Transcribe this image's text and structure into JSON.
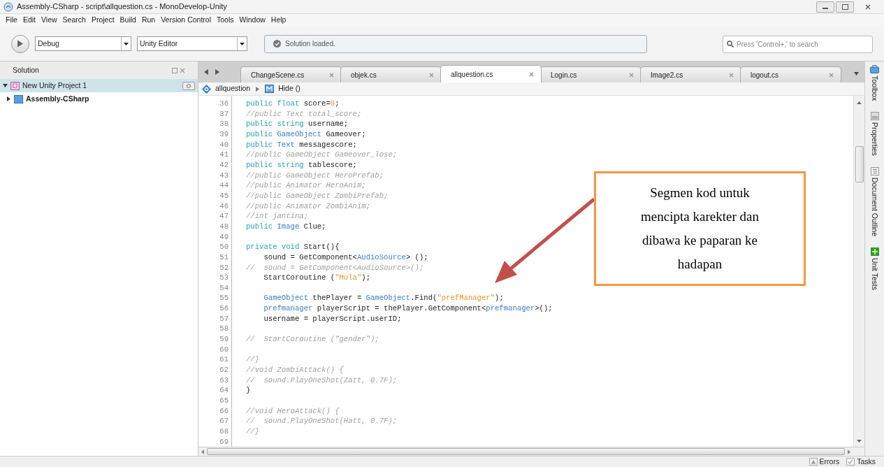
{
  "window": {
    "title": "Assembly-CSharp - script\\allquestion.cs - MonoDevelop-Unity"
  },
  "menu": [
    "File",
    "Edit",
    "View",
    "Search",
    "Project",
    "Build",
    "Run",
    "Version Control",
    "Tools",
    "Window",
    "Help"
  ],
  "toolbar": {
    "configuration": "Debug",
    "target": "Unity Editor",
    "status": "Solution loaded.",
    "search": {
      "placeholder": "Press 'Control+,' to search"
    }
  },
  "solution_pad": {
    "title": "Solution",
    "tree": [
      {
        "label": "New Unity Project 1",
        "expanded": true,
        "selected": true,
        "children": [
          {
            "label": "Assembly-CSharp",
            "expanded": false,
            "selected": false
          }
        ]
      }
    ]
  },
  "tabs": [
    {
      "label": "ChangeScene.cs",
      "selected": false
    },
    {
      "label": "objek.cs",
      "selected": false
    },
    {
      "label": "allquestion.cs",
      "selected": true
    },
    {
      "label": "Login.cs",
      "selected": false
    },
    {
      "label": "Image2.cs",
      "selected": false
    },
    {
      "label": "logout.cs",
      "selected": false
    }
  ],
  "breadcrumb": [
    {
      "label": "allquestion",
      "kind": "class"
    },
    {
      "label": "Hide ()",
      "kind": "method"
    }
  ],
  "code": [
    {
      "number": "36",
      "segments": [
        {
          "text": "public float ",
          "kind": "keyword"
        },
        {
          "text": "score=",
          "kind": "plain"
        },
        {
          "text": "0",
          "kind": "number"
        },
        {
          "text": ";",
          "kind": "plain"
        }
      ]
    },
    {
      "number": "37",
      "segments": [
        {
          "text": "//public Text total_score;",
          "kind": "comment"
        }
      ]
    },
    {
      "number": "38",
      "segments": [
        {
          "text": "public string ",
          "kind": "keyword"
        },
        {
          "text": "username;",
          "kind": "plain"
        }
      ]
    },
    {
      "number": "39",
      "segments": [
        {
          "text": "public ",
          "kind": "keyword"
        },
        {
          "text": "GameObject ",
          "kind": "type"
        },
        {
          "text": "Gameover;",
          "kind": "plain"
        }
      ]
    },
    {
      "number": "40",
      "segments": [
        {
          "text": "public ",
          "kind": "keyword"
        },
        {
          "text": "Text ",
          "kind": "type"
        },
        {
          "text": "messagescore;",
          "kind": "plain"
        }
      ]
    },
    {
      "number": "41",
      "segments": [
        {
          "text": "//public GameObject Gameover_lose;",
          "kind": "comment"
        }
      ]
    },
    {
      "number": "42",
      "segments": [
        {
          "text": "public string ",
          "kind": "keyword"
        },
        {
          "text": "tablescore;",
          "kind": "plain"
        }
      ]
    },
    {
      "number": "43",
      "segments": [
        {
          "text": "//public GameObject HeroPrefab;",
          "kind": "comment"
        }
      ]
    },
    {
      "number": "44",
      "segments": [
        {
          "text": "//public Animator HeroAnim;",
          "kind": "comment"
        }
      ]
    },
    {
      "number": "45",
      "segments": [
        {
          "text": "//public GameObject ZombiPrefab;",
          "kind": "comment"
        }
      ]
    },
    {
      "number": "46",
      "segments": [
        {
          "text": "//public Animator ZombiAnim;",
          "kind": "comment"
        }
      ]
    },
    {
      "number": "47",
      "segments": [
        {
          "text": "//int jantina;",
          "kind": "comment"
        }
      ]
    },
    {
      "number": "48",
      "segments": [
        {
          "text": "public ",
          "kind": "keyword"
        },
        {
          "text": "Image ",
          "kind": "type"
        },
        {
          "text": "Clue;",
          "kind": "plain"
        }
      ]
    },
    {
      "number": "49"
    },
    {
      "number": "50",
      "segments": [
        {
          "text": "private void ",
          "kind": "keyword"
        },
        {
          "text": "Start(){",
          "kind": "plain"
        }
      ]
    },
    {
      "number": "51",
      "segments": [
        {
          "text": "    sound = GetComponent<",
          "kind": "plain"
        },
        {
          "text": "AudioSource",
          "kind": "type"
        },
        {
          "text": "> ();",
          "kind": "plain"
        }
      ]
    },
    {
      "number": "52",
      "segments": [
        {
          "text": "//  sound = GetComponent<AudioSource>();",
          "kind": "comment"
        }
      ]
    },
    {
      "number": "53",
      "segments": [
        {
          "text": "    StartCoroutine (",
          "kind": "plain"
        },
        {
          "text": "\"Mula\"",
          "kind": "string"
        },
        {
          "text": ");",
          "kind": "plain"
        }
      ]
    },
    {
      "number": "54"
    },
    {
      "number": "55",
      "segments": [
        {
          "text": "    GameObject ",
          "kind": "type"
        },
        {
          "text": "thePlayer = ",
          "kind": "plain"
        },
        {
          "text": "GameObject",
          "kind": "type"
        },
        {
          "text": ".Find(",
          "kind": "plain"
        },
        {
          "text": "\"prefManager\"",
          "kind": "string"
        },
        {
          "text": ");",
          "kind": "plain"
        }
      ]
    },
    {
      "number": "56",
      "segments": [
        {
          "text": "    prefmanager ",
          "kind": "type"
        },
        {
          "text": "playerScript = thePlayer.GetComponent<",
          "kind": "plain"
        },
        {
          "text": "prefmanager",
          "kind": "type"
        },
        {
          "text": ">();",
          "kind": "plain"
        }
      ]
    },
    {
      "number": "57",
      "segments": [
        {
          "text": "    username = playerScript.userID;",
          "kind": "plain"
        }
      ]
    },
    {
      "number": "58"
    },
    {
      "number": "59",
      "segments": [
        {
          "text": "//  StartCoroutine (\"gender\");",
          "kind": "comment"
        }
      ]
    },
    {
      "number": "60"
    },
    {
      "number": "61",
      "segments": [
        {
          "text": "//}",
          "kind": "comment"
        }
      ]
    },
    {
      "number": "62",
      "segments": [
        {
          "text": "//void ZombiAttack() {",
          "kind": "comment"
        }
      ]
    },
    {
      "number": "63",
      "segments": [
        {
          "text": "//  sound.PlayOneShot(Zatt, 0.7F);",
          "kind": "comment"
        }
      ]
    },
    {
      "number": "64",
      "segments": [
        {
          "text": "}",
          "kind": "plain"
        }
      ]
    },
    {
      "number": "65"
    },
    {
      "number": "66",
      "segments": [
        {
          "text": "//void HeroAttack() {",
          "kind": "comment"
        }
      ]
    },
    {
      "number": "67",
      "segments": [
        {
          "text": "//  sound.PlayOneShot(Hatt, 0.7F);",
          "kind": "comment"
        }
      ]
    },
    {
      "number": "68",
      "segments": [
        {
          "text": "//}",
          "kind": "comment"
        }
      ]
    },
    {
      "number": "69"
    }
  ],
  "right_dock": [
    "Toolbox",
    "Properties",
    "Document Outline",
    "Unit Tests"
  ],
  "callout": {
    "text": "Segmen kod untuk mencipta karekter dan dibawa ke paparan ke hadapan"
  },
  "status_bar": {
    "errors": "Errors",
    "tasks": "Tasks"
  }
}
